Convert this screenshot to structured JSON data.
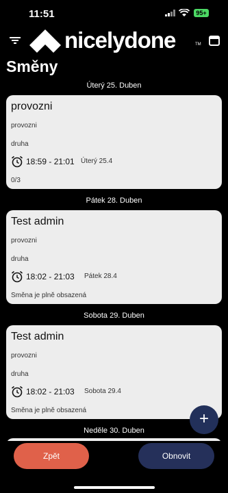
{
  "status_bar": {
    "time": "11:51",
    "battery": "95+"
  },
  "header": {
    "brand": "nicelydone",
    "trademark": "TM"
  },
  "page_title": "Směny",
  "sections": [
    {
      "date": "Úterý 25. Duben",
      "card": {
        "title": "provozni",
        "line1": "provozni",
        "line2": "druha",
        "time": "18:59 - 21:01",
        "day": "Úterý 25.4",
        "status": "0/3"
      }
    },
    {
      "date": "Pátek 28. Duben",
      "card": {
        "title": "Test admin",
        "line1": "provozni",
        "line2": "druha",
        "time": "18:02 - 21:03",
        "day": "Pátek 28.4",
        "status": "Směna je plně obsazená"
      }
    },
    {
      "date": "Sobota 29. Duben",
      "card": {
        "title": "Test admin",
        "line1": "provozni",
        "line2": "druha",
        "time": "18:02 - 21:03",
        "day": "Sobota 29.4",
        "status": "Směna je plně obsazená"
      }
    },
    {
      "date": "Neděle 30. Duben"
    }
  ],
  "fab_label": "+",
  "buttons": {
    "back": "Zpět",
    "refresh": "Obnovit"
  },
  "icons": {
    "menu": "filter-menu-icon",
    "calendar": "calendar-icon",
    "alarm": "alarm-clock-icon",
    "add": "plus-icon"
  },
  "colors": {
    "background": "#000000",
    "card": "#ededed",
    "back_button": "#e0614a",
    "primary": "#25305a",
    "battery": "#4cd964"
  }
}
